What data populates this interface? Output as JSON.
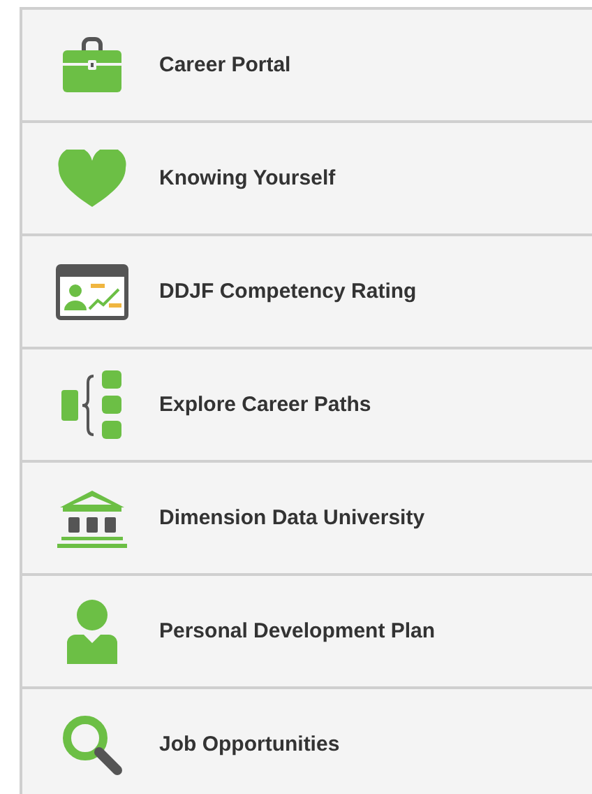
{
  "menu": {
    "items": [
      {
        "kind": "briefcase",
        "label": "Career Portal"
      },
      {
        "kind": "heart",
        "label": "Knowing Yourself"
      },
      {
        "kind": "scoreboard",
        "label": "DDJF Competency Rating"
      },
      {
        "kind": "paths",
        "label": "Explore Career Paths"
      },
      {
        "kind": "university",
        "label": "Dimension Data University"
      },
      {
        "kind": "person",
        "label": "Personal Development Plan"
      },
      {
        "kind": "search",
        "label": "Job Opportunities"
      }
    ]
  }
}
